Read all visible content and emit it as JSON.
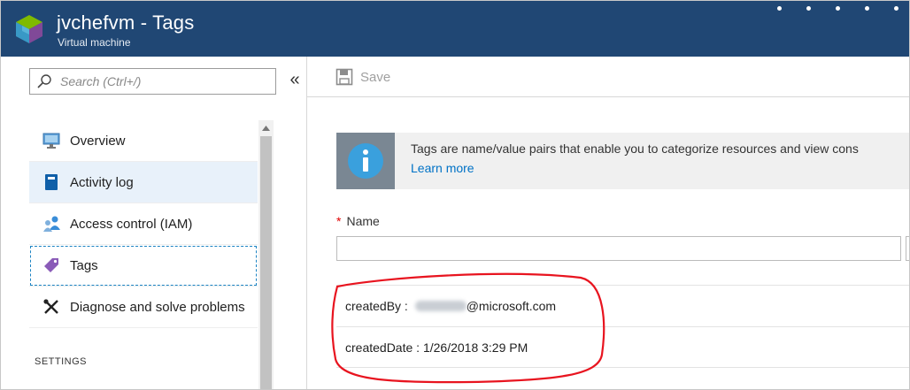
{
  "header": {
    "title": "jvchefvm - Tags",
    "subtitle": "Virtual machine",
    "icon": "virtual-machine-icon",
    "color": "#204774"
  },
  "sidebar": {
    "search": {
      "placeholder": "Search (Ctrl+/)",
      "value": ""
    },
    "collapse_label": "«",
    "items": [
      {
        "label": "Overview",
        "icon": "monitor-icon"
      },
      {
        "label": "Activity log",
        "icon": "log-book-icon",
        "state": "hover"
      },
      {
        "label": "Access control (IAM)",
        "icon": "users-icon"
      },
      {
        "label": "Tags",
        "icon": "tag-icon",
        "state": "selected"
      },
      {
        "label": "Diagnose and solve problems",
        "icon": "wrench-icon"
      }
    ],
    "section_label": "SETTINGS"
  },
  "toolbar": {
    "save_label": "Save",
    "save_enabled": false
  },
  "info": {
    "text": "Tags are name/value pairs that enable you to categorize resources and view cons",
    "link": "Learn more"
  },
  "form": {
    "name_label": "Name",
    "required_marker": "*",
    "name_value": ""
  },
  "tags": [
    {
      "key": "createdBy",
      "separator": " : ",
      "value": "@microsoft.com",
      "redacted_prefix": true
    },
    {
      "key": "createdDate",
      "separator": " : ",
      "value": "1/26/2018 3:29 PM",
      "redacted_prefix": false
    }
  ],
  "colors": {
    "accent": "#0072c6",
    "required": "#e00000",
    "annotation": "#e8141f"
  }
}
